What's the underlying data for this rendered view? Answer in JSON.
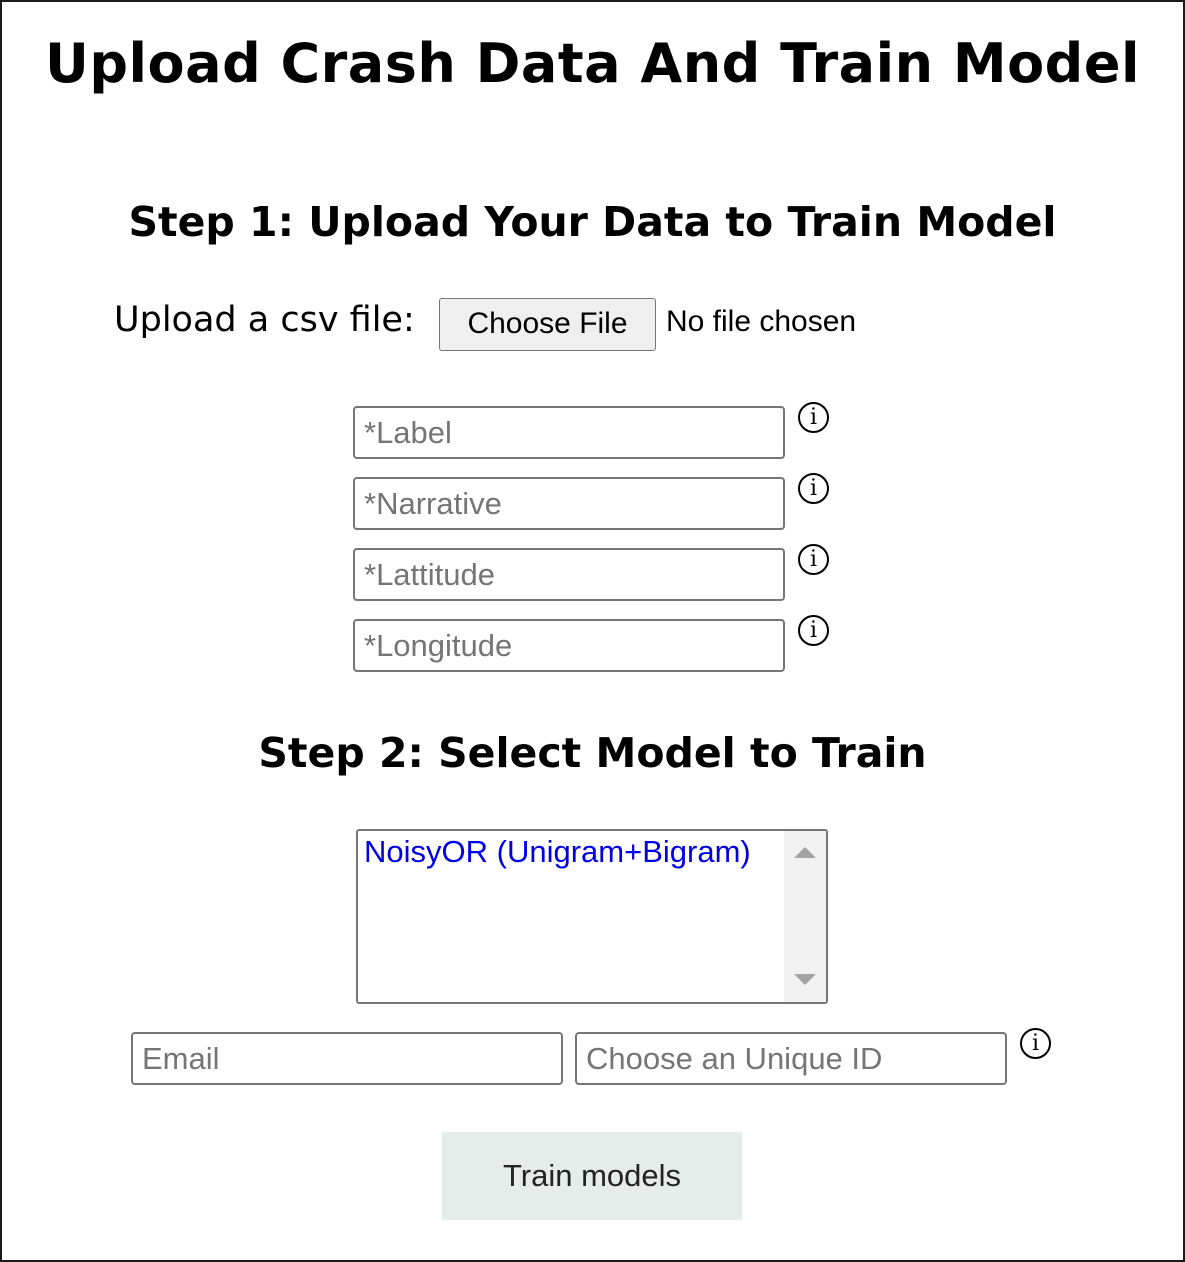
{
  "page": {
    "title": "Upload Crash Data And Train Model"
  },
  "step1": {
    "heading": "Step 1: Upload Your Data to Train Model",
    "upload_label": "Upload a csv file:",
    "choose_file_label": "Choose File",
    "file_status": "No file chosen",
    "fields": {
      "label_placeholder": "*Label",
      "narrative_placeholder": "*Narrative",
      "latitude_placeholder": "*Lattitude",
      "longitude_placeholder": "*Longitude"
    },
    "info_glyph": "i"
  },
  "step2": {
    "heading": "Step 2: Select Model to Train",
    "model_options": [
      "NoisyOR (Unigram+Bigram)"
    ],
    "email_placeholder": "Email",
    "unique_id_placeholder": "Choose an Unique ID",
    "train_button_label": "Train models"
  },
  "icons": {
    "info": "info-circle-icon",
    "scroll_up": "scroll-up-arrow-icon",
    "scroll_down": "scroll-down-arrow-icon"
  },
  "colors": {
    "option_text": "#0000e6",
    "train_button_bg": "#e6ece9"
  }
}
